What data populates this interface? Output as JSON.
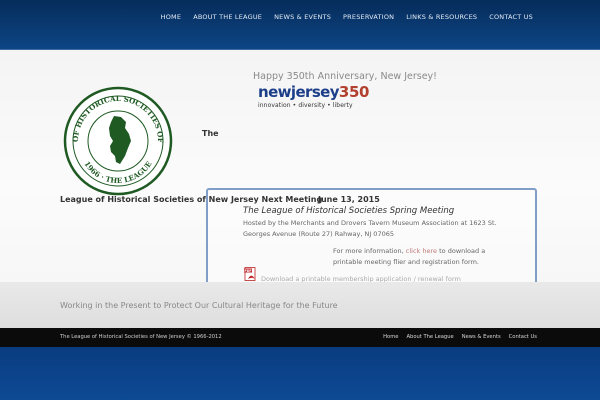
{
  "nav": {
    "items": [
      "HOME",
      "ABOUT THE LEAGUE",
      "NEWS & EVENTS",
      "PRESERVATION",
      "LINKS & RESOURCES",
      "CONTACT US"
    ]
  },
  "seal": {
    "top_text": "THE LEAGUE OF HISTORICAL SOCIETIES OF NEW JERSEY",
    "bottom_text": "1966 · THE LEAGUE"
  },
  "intro": {
    "the_label": "The"
  },
  "anniversary": {
    "headline": "Happy 350th Anniversary, New Jersey!",
    "logo_word": "newjersey",
    "logo_number": "350",
    "logo_tagline": "innovation • diversity • liberty"
  },
  "meeting": {
    "heading": "League of Historical Societies of New Jersey Next Meeting",
    "date": "June 13, 2015",
    "title": "The League of Historical Societies Spring Meeting",
    "host": "Hosted by the Merchants and Drovers Tavern Museum Association at 1623 St. Georges Avenue (Route 27) Rahway, NJ 07065",
    "info_prefix": "For more information,",
    "info_link": "click here",
    "info_suffix": "to download a printable meeting flier and registration form.",
    "pdf_label": "Download a printable membership application / renewal form",
    "pdf_icon": "pdf-icon"
  },
  "tagline": "Working in the Present to Protect Our Cultural Heritage for the Future",
  "footer": {
    "copyright": "The League of Historical Societies of New Jersey © 1966-2012",
    "links": [
      "Home",
      "About The League",
      "News & Events",
      "Contact Us"
    ]
  },
  "colors": {
    "header": "#0a3a72",
    "footer": "#0b0b0b",
    "bottom": "#0d4a94",
    "seal_green": "#1f5a23"
  }
}
